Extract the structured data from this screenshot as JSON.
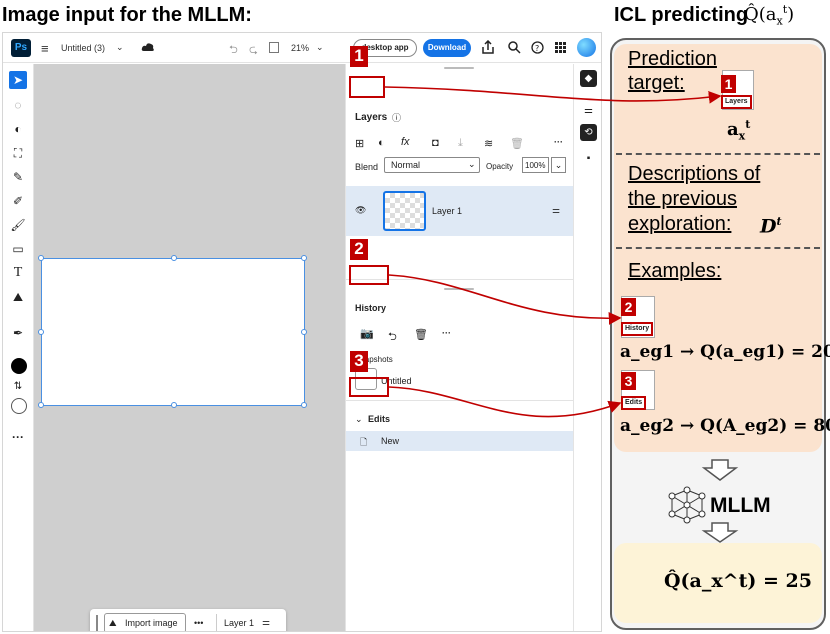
{
  "headings": {
    "left": "Image input for the MLLM:",
    "right": "ICL predicting"
  },
  "app": {
    "logo": "Ps",
    "doc_title": "Untitled (3)",
    "zoom": "21%",
    "open_desktop": "desktop app",
    "download": "Download"
  },
  "layers_panel": {
    "title": "Layers",
    "blend_label": "Blend",
    "blend_value": "Normal",
    "opacity_label": "Opacity",
    "opacity_value": "100%",
    "layer_name": "Layer 1"
  },
  "history_panel": {
    "title": "History",
    "snapshots_label": "Snapshots",
    "snapshot_name": "Untitled",
    "edits_label": "Edits",
    "edit_item": "New"
  },
  "bottom_bar": {
    "import_label": "Import image",
    "more": "•••",
    "layer_label": "Layer 1"
  },
  "badges": {
    "one": "1",
    "two": "2",
    "three": "3"
  },
  "right": {
    "pred_target": [
      "Prediction",
      "target:"
    ],
    "desc": [
      "Descriptions of",
      "the previous",
      "exploration:"
    ],
    "desc_var": "D",
    "examples": "Examples:",
    "eq1": "a_eg1 → Q(a_eg1) = 20",
    "eq2": "a_eg2 → Q(A_eg2) = 80",
    "mllm": "MLLM",
    "result": "Q̂(a_x^t) = 25",
    "thumb_layers": "Layers",
    "thumb_history": "History",
    "thumb_edits": "Edits"
  },
  "colors": {
    "accent_red": "#c00000",
    "blue": "#1473e6",
    "peach": "#fbe3cf",
    "yellow": "#fdf3d7"
  }
}
